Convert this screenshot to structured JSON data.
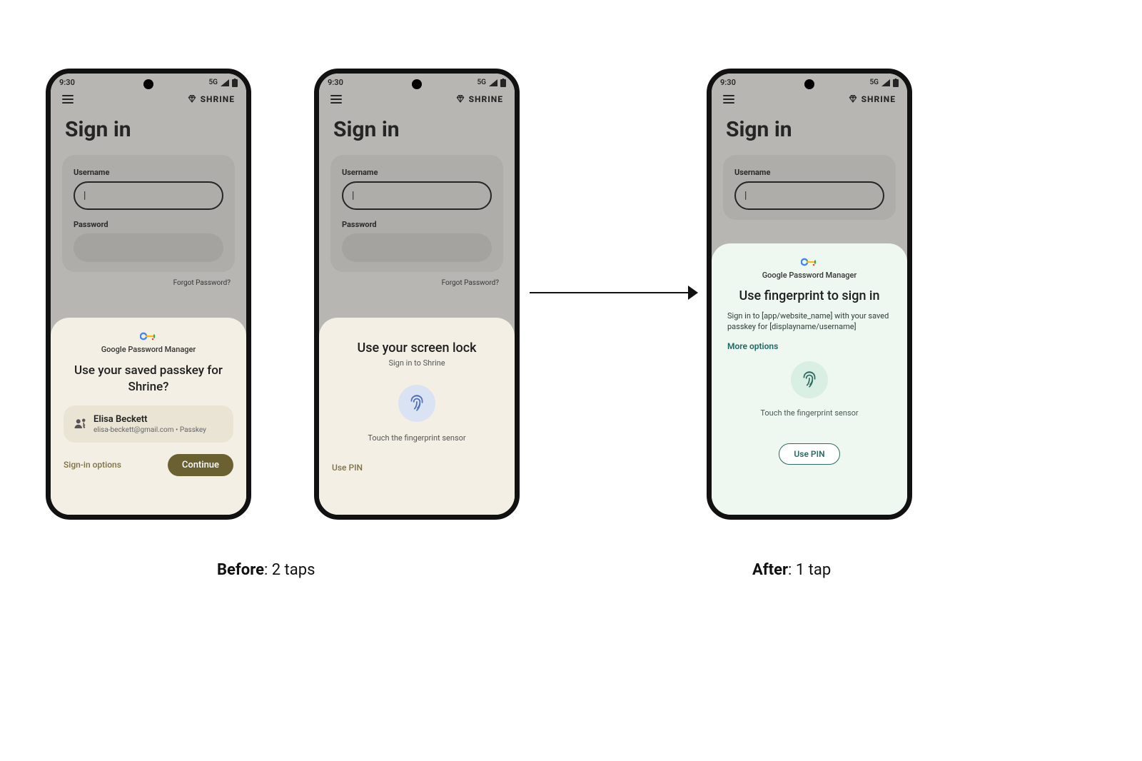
{
  "status": {
    "time": "9:30",
    "network": "5G"
  },
  "brand": "SHRINE",
  "page_title": "Sign in",
  "form": {
    "username_label": "Username",
    "username_value": "|",
    "password_label": "Password",
    "forgot": "Forgot Password?"
  },
  "gpm_label": "Google Password Manager",
  "phone1": {
    "sheet_title": "Use your saved passkey for Shrine?",
    "account_name": "Elisa Beckett",
    "account_sub": "elisa-beckett@gmail.com • Passkey",
    "signin_options": "Sign-in options",
    "continue": "Continue"
  },
  "phone2": {
    "sheet_title": "Use your screen lock",
    "sheet_sub": "Sign in to Shrine",
    "fp_cap": "Touch the fingerprint sensor",
    "use_pin": "Use PIN"
  },
  "phone3": {
    "sheet_title": "Use fingerprint to sign in",
    "sheet_sub": "Sign in to [app/website_name] with your saved passkey for [displayname/username]",
    "more": "More options",
    "fp_cap": "Touch the fingerprint sensor",
    "use_pin": "Use PIN"
  },
  "caption1_bold": "Before",
  "caption1_rest": ": 2 taps",
  "caption2_bold": "After",
  "caption2_rest": ": 1 tap"
}
